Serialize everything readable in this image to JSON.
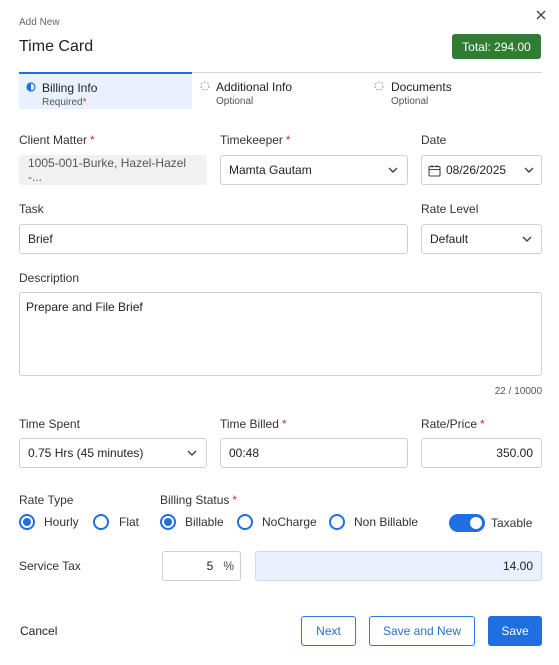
{
  "header": {
    "subtitle": "Add New",
    "title": "Time Card",
    "total": "Total: 294.00"
  },
  "steps": [
    {
      "title": "Billing Info",
      "sub": "Required",
      "sub_required_mark": "*"
    },
    {
      "title": "Additional Info",
      "sub": "Optional"
    },
    {
      "title": "Documents",
      "sub": "Optional"
    }
  ],
  "fields": {
    "client_matter": {
      "label": "Client Matter",
      "value": "1005-001-Burke, Hazel-Hazel -..."
    },
    "timekeeper": {
      "label": "Timekeeper",
      "value": "Mamta Gautam"
    },
    "date": {
      "label": "Date",
      "value": "08/26/2025"
    },
    "task": {
      "label": "Task",
      "value": "Brief"
    },
    "rate_level": {
      "label": "Rate Level",
      "value": "Default"
    },
    "description": {
      "label": "Description",
      "value": "Prepare and File Brief",
      "counter": "22 / 10000"
    },
    "time_spent": {
      "label": "Time Spent",
      "value": "0.75 Hrs (45 minutes)"
    },
    "time_billed": {
      "label": "Time Billed",
      "value": "00:48"
    },
    "rate_price": {
      "label": "Rate/Price",
      "value": "350.00"
    }
  },
  "rate_type": {
    "label": "Rate Type",
    "options": [
      "Hourly",
      "Flat"
    ],
    "selected": "Hourly"
  },
  "billing_status": {
    "label": "Billing Status",
    "options": [
      "Billable",
      "NoCharge",
      "Non Billable"
    ],
    "selected": "Billable"
  },
  "taxable": {
    "label": "Taxable",
    "on": true
  },
  "service_tax": {
    "label": "Service Tax",
    "percent": "5",
    "percent_symbol": "%",
    "amount": "14.00"
  },
  "footer": {
    "cancel": "Cancel",
    "next": "Next",
    "save_and_new": "Save and New",
    "save": "Save"
  },
  "colors": {
    "accent": "#1f6fe0",
    "total_badge": "#2e7d32",
    "active_step_bg": "#e8f1fd"
  }
}
